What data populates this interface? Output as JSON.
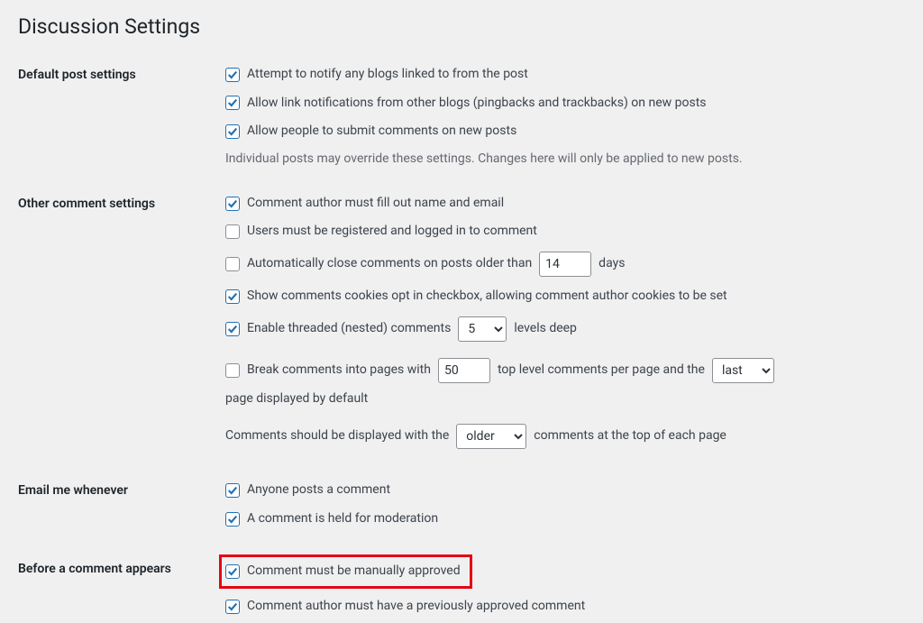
{
  "page_title": "Discussion Settings",
  "sections": {
    "default_post": {
      "heading": "Default post settings",
      "notify_blogs": "Attempt to notify any blogs linked to from the post",
      "allow_pingbacks": "Allow link notifications from other blogs (pingbacks and trackbacks) on new posts",
      "allow_comments": "Allow people to submit comments on new posts",
      "note": "Individual posts may override these settings. Changes here will only be applied to new posts."
    },
    "other_comment": {
      "heading": "Other comment settings",
      "fill_name_email": "Comment author must fill out name and email",
      "must_register": "Users must be registered and logged in to comment",
      "auto_close_pre": "Automatically close comments on posts older than",
      "auto_close_days_value": "14",
      "auto_close_post": "days",
      "cookies_opt": "Show comments cookies opt in checkbox, allowing comment author cookies to be set",
      "threaded_pre": "Enable threaded (nested) comments",
      "threaded_value": "5",
      "threaded_post": "levels deep",
      "break_pre": "Break comments into pages with",
      "break_value": "50",
      "break_mid": "top level comments per page and the",
      "break_select_value": "last",
      "break_post": "page displayed by default",
      "display_pre": "Comments should be displayed with the",
      "display_value": "older",
      "display_post": "comments at the top of each page"
    },
    "email_me": {
      "heading": "Email me whenever",
      "anyone_posts": "Anyone posts a comment",
      "held_moderation": "A comment is held for moderation"
    },
    "before_appears": {
      "heading": "Before a comment appears",
      "manual_approve": "Comment must be manually approved",
      "prev_approved": "Comment author must have a previously approved comment"
    }
  }
}
